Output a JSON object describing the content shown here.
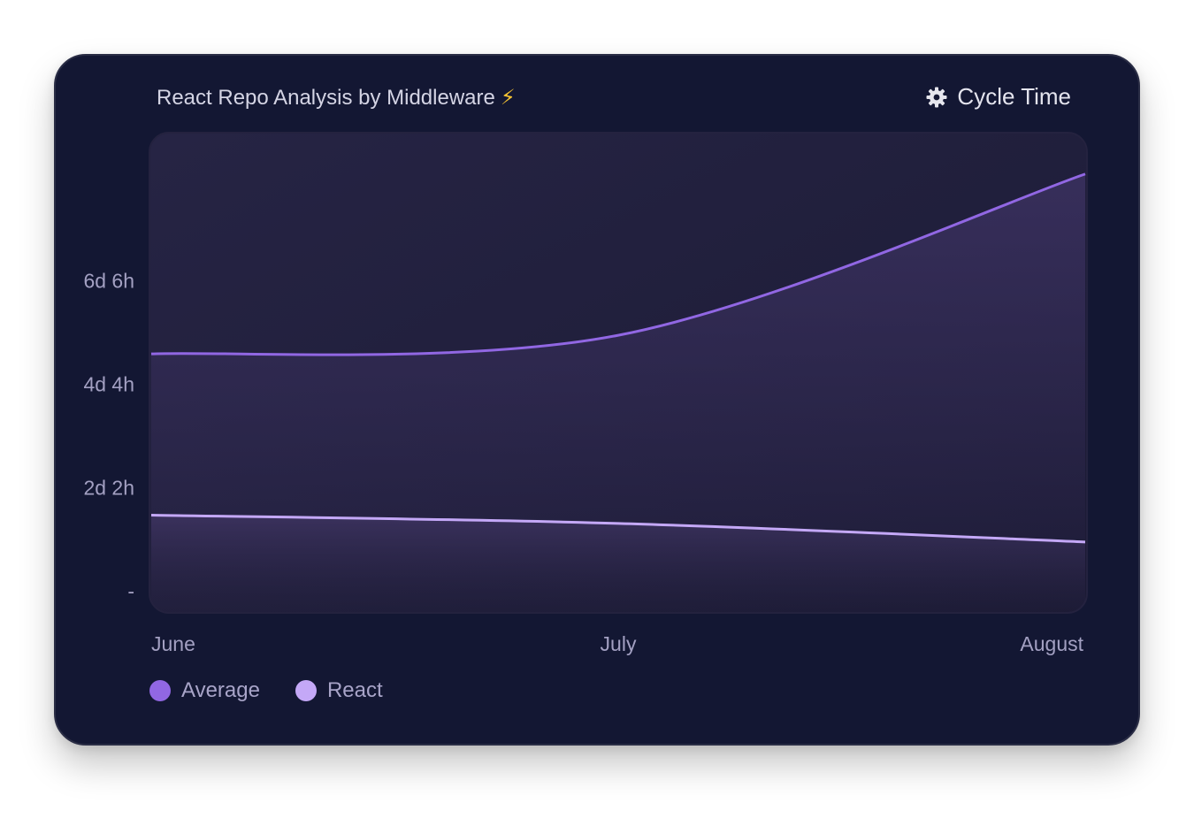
{
  "header": {
    "title": "React Repo Analysis by Middleware",
    "title_emoji": "⚡",
    "metric_icon": "gear-icon",
    "metric_label": "Cycle Time"
  },
  "chart_data": {
    "type": "area",
    "title": "React Repo Analysis by Middleware ⚡",
    "xlabel": "",
    "ylabel": "",
    "categories": [
      "June",
      "July",
      "August"
    ],
    "y_tick_labels": [
      "6d 6h",
      "4d 4h",
      "2d 2h",
      "-"
    ],
    "y_tick_values_hours": [
      150,
      100,
      50,
      0
    ],
    "ylim_hours": [
      0,
      222
    ],
    "grid": false,
    "legend_position": "bottom-left",
    "series": [
      {
        "name": "Average",
        "values_hours": [
          115,
          124,
          202
        ],
        "color": "#9167e3"
      },
      {
        "name": "React",
        "values_hours": [
          37,
          33,
          24
        ],
        "color": "#c4a8f7"
      }
    ]
  },
  "legend": {
    "items": [
      {
        "label": "Average",
        "color": "#9167e3"
      },
      {
        "label": "React",
        "color": "#c4a8f7"
      }
    ]
  }
}
